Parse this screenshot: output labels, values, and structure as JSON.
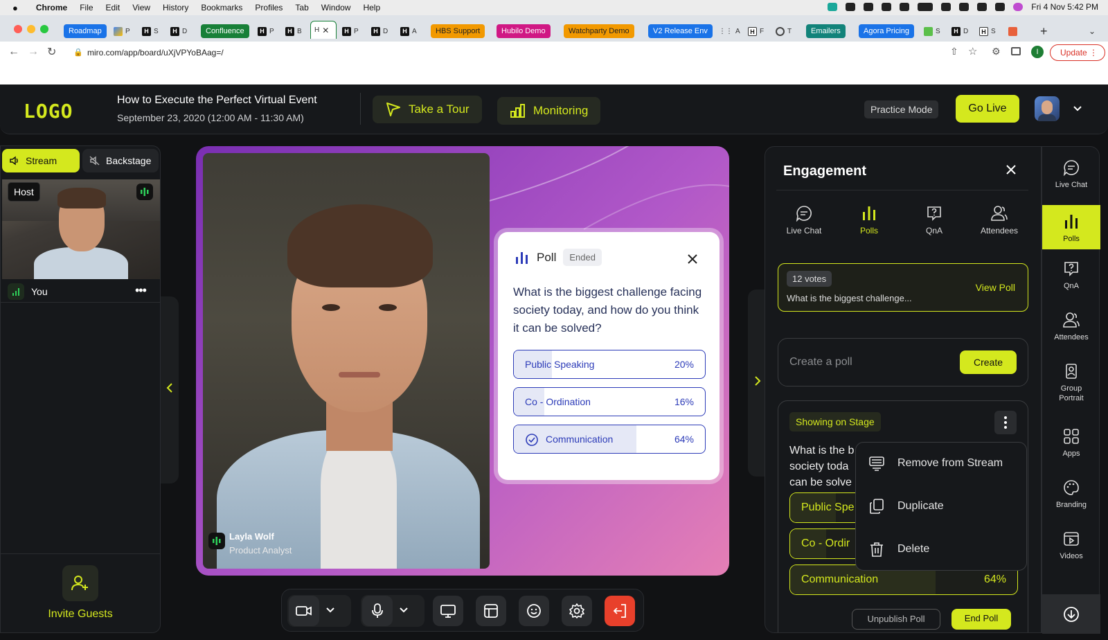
{
  "menubar": {
    "app": "Chrome",
    "items": [
      "File",
      "Edit",
      "View",
      "History",
      "Bookmarks",
      "Profiles",
      "Tab",
      "Window",
      "Help"
    ],
    "datetime": "Fri 4 Nov  5:42 PM"
  },
  "tabs": {
    "chips": [
      {
        "label": "Roadmap",
        "color": "#1a73e8"
      },
      {
        "label": "Confluence",
        "color": "#188038"
      },
      {
        "label": "HBS Support",
        "color": "#f29900"
      },
      {
        "label": "Hubilo Demo",
        "color": "#d01884"
      },
      {
        "label": "Watchparty Demo",
        "color": "#f29900"
      },
      {
        "label": "V2 Release Env",
        "color": "#1a73e8"
      },
      {
        "label": "Emailers",
        "color": "#12837a"
      },
      {
        "label": "Agora Pricing",
        "color": "#1a73e8"
      }
    ],
    "mini": [
      "P",
      "S",
      "D",
      "P",
      "B",
      "H",
      "P",
      "D",
      "A",
      "A",
      "F",
      "T",
      "S",
      "D",
      "S"
    ]
  },
  "address": {
    "url": "miro.com/app/board/uXjVPYoBAag=/",
    "update_label": "Update",
    "profile_initial": "I"
  },
  "header": {
    "logo": "LOGO",
    "event_title": "How to Execute the Perfect Virtual Event",
    "event_date": "September 23, 2020 (12:00 AM - 11:30 AM)",
    "tour_label": "Take a Tour",
    "monitoring_label": "Monitoring",
    "practice_label": "Practice Mode",
    "golive_label": "Go Live"
  },
  "left": {
    "stream_label": "Stream",
    "backstage_label": "Backstage",
    "host_label": "Host",
    "you_label": "You",
    "invite_label": "Invite Guests"
  },
  "stage": {
    "speaker_name": "Layla Wolf",
    "speaker_role": "Product Analyst",
    "poll": {
      "title": "Poll",
      "status": "Ended",
      "question": "What is the biggest challenge facing society today, and how do you think it can be solved?",
      "options": [
        {
          "label": "Public Speaking",
          "percent": "20%",
          "value": 20
        },
        {
          "label": "Co - Ordination",
          "percent": "16%",
          "value": 16
        },
        {
          "label": "Communication",
          "percent": "64%",
          "value": 64
        }
      ]
    }
  },
  "engagement": {
    "title": "Engagement",
    "tabs": [
      "Live Chat",
      "Polls",
      "QnA",
      "Attendees"
    ],
    "votes": "12 votes",
    "vote_question": "What is the biggest challenge...",
    "view_poll": "View Poll",
    "create_placeholder": "Create a poll",
    "create_label": "Create",
    "showing_tag": "Showing on Stage",
    "stage_question_lines": [
      "What is the b",
      "society toda",
      "can be solve"
    ],
    "stage_options": [
      {
        "label": "Public Spe",
        "percent": "",
        "value": 20
      },
      {
        "label": "Co - Ordir",
        "percent": "",
        "value": 16
      },
      {
        "label": "Communication",
        "percent": "64%",
        "value": 64
      }
    ],
    "bottom_left": "Unpublish Poll",
    "bottom_right": "End Poll"
  },
  "context_menu": {
    "items": [
      "Remove from Stream",
      "Duplicate",
      "Delete"
    ]
  },
  "rail": {
    "items": [
      "Live Chat",
      "Polls",
      "QnA",
      "Attendees",
      "Group Portrait",
      "Apps",
      "Branding",
      "Videos"
    ]
  },
  "colors": {
    "accent": "#d4e81e",
    "poll_blue": "#2c3bb8",
    "end_red": "#e8402b"
  }
}
